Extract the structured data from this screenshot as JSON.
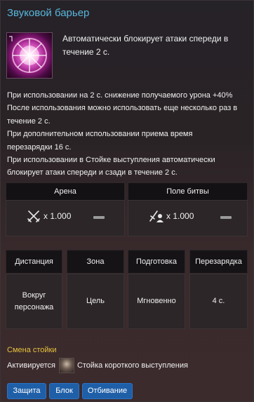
{
  "skill": {
    "title": "Звуковой барьер",
    "summary": "Автоматически блокирует атаки спереди в течение 2 с."
  },
  "description": [
    "При использовании на 2 с. снижение получаемого урона +40%",
    "После использования можно использовать еще несколько раз в",
    "течение 2 с.",
    "При дополнительном использовании приема время",
    "перезарядки 16 с.",
    "При использовании в Стойке выступления автоматически",
    "блокирует атаки спереди и сзади в течение 2 с."
  ],
  "pvp": {
    "arena_label": "Арена",
    "battlefield_label": "Поле битвы",
    "arena_value": "x 1.000",
    "battlefield_value": "x 1.000"
  },
  "stats": {
    "distance_label": "Дистанция",
    "area_label": "Зона",
    "prep_label": "Подготовка",
    "cooldown_label": "Перезарядка",
    "distance_value": "Вокруг персонажа",
    "area_value": "Цель",
    "prep_value": "Мгновенно",
    "cooldown_value": "4 с."
  },
  "stance": {
    "title": "Смена стойки",
    "activates_label": "Активируется",
    "stance_name": "Стойка короткого выступления"
  },
  "tags": [
    "Защита",
    "Блок",
    "Отбивание"
  ],
  "colors": {
    "title": "#58b6dc",
    "stance_title": "#e6c23c",
    "tag_bg": "#1f5fa8"
  }
}
